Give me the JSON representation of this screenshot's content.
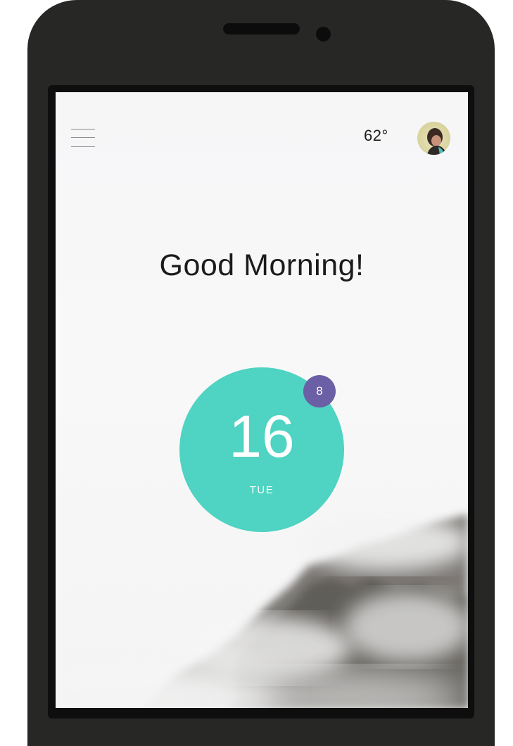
{
  "header": {
    "temperature": "62°",
    "avatar_alt": "user-avatar"
  },
  "main": {
    "greeting": "Good Morning!",
    "date": {
      "day_number": "16",
      "weekday": "TUE"
    },
    "notification_badge": "8"
  },
  "colors": {
    "accent": "#4fd3c2",
    "badge": "#6b5fa6",
    "phone_body": "#272826"
  }
}
